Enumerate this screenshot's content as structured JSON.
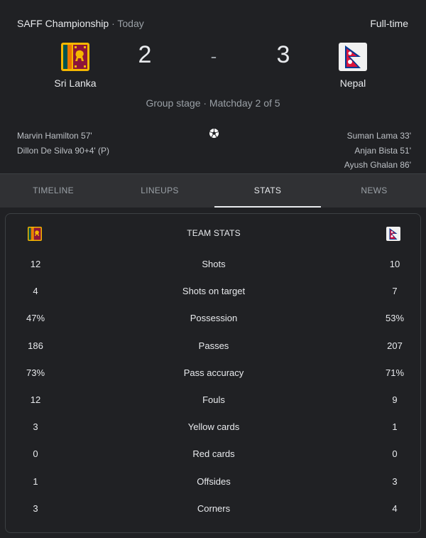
{
  "header": {
    "competition": "SAFF Championship",
    "separator": "·",
    "when": "Today",
    "status": "Full-time",
    "stage": "Group stage · Matchday 2 of 5"
  },
  "home": {
    "name": "Sri Lanka",
    "score": "2",
    "scorers": [
      "Marvin Hamilton 57'",
      "Dillon De Silva 90+4' (P)"
    ]
  },
  "away": {
    "name": "Nepal",
    "score": "3",
    "scorers": [
      "Suman Lama 33'",
      "Anjan Bista 51'",
      "Ayush Ghalan 86'"
    ]
  },
  "score_separator": "-",
  "tabs": [
    "TIMELINE",
    "LINEUPS",
    "STATS",
    "NEWS"
  ],
  "active_tab": "STATS",
  "stats": {
    "title": "TEAM STATS",
    "rows": [
      {
        "label": "Shots",
        "home": "12",
        "away": "10"
      },
      {
        "label": "Shots on target",
        "home": "4",
        "away": "7"
      },
      {
        "label": "Possession",
        "home": "47%",
        "away": "53%"
      },
      {
        "label": "Passes",
        "home": "186",
        "away": "207"
      },
      {
        "label": "Pass accuracy",
        "home": "73%",
        "away": "71%"
      },
      {
        "label": "Fouls",
        "home": "12",
        "away": "9"
      },
      {
        "label": "Yellow cards",
        "home": "3",
        "away": "1"
      },
      {
        "label": "Red cards",
        "home": "0",
        "away": "0"
      },
      {
        "label": "Offsides",
        "home": "1",
        "away": "3"
      },
      {
        "label": "Corners",
        "home": "3",
        "away": "4"
      }
    ]
  },
  "colors": {
    "background": "#202124",
    "tabs_background": "#303134",
    "text": "#e8eaed",
    "muted": "#9aa0a6"
  },
  "icons": {
    "home_flag": "sri-lanka-flag-icon",
    "away_flag": "nepal-flag-icon",
    "goal": "soccer-ball-icon"
  }
}
